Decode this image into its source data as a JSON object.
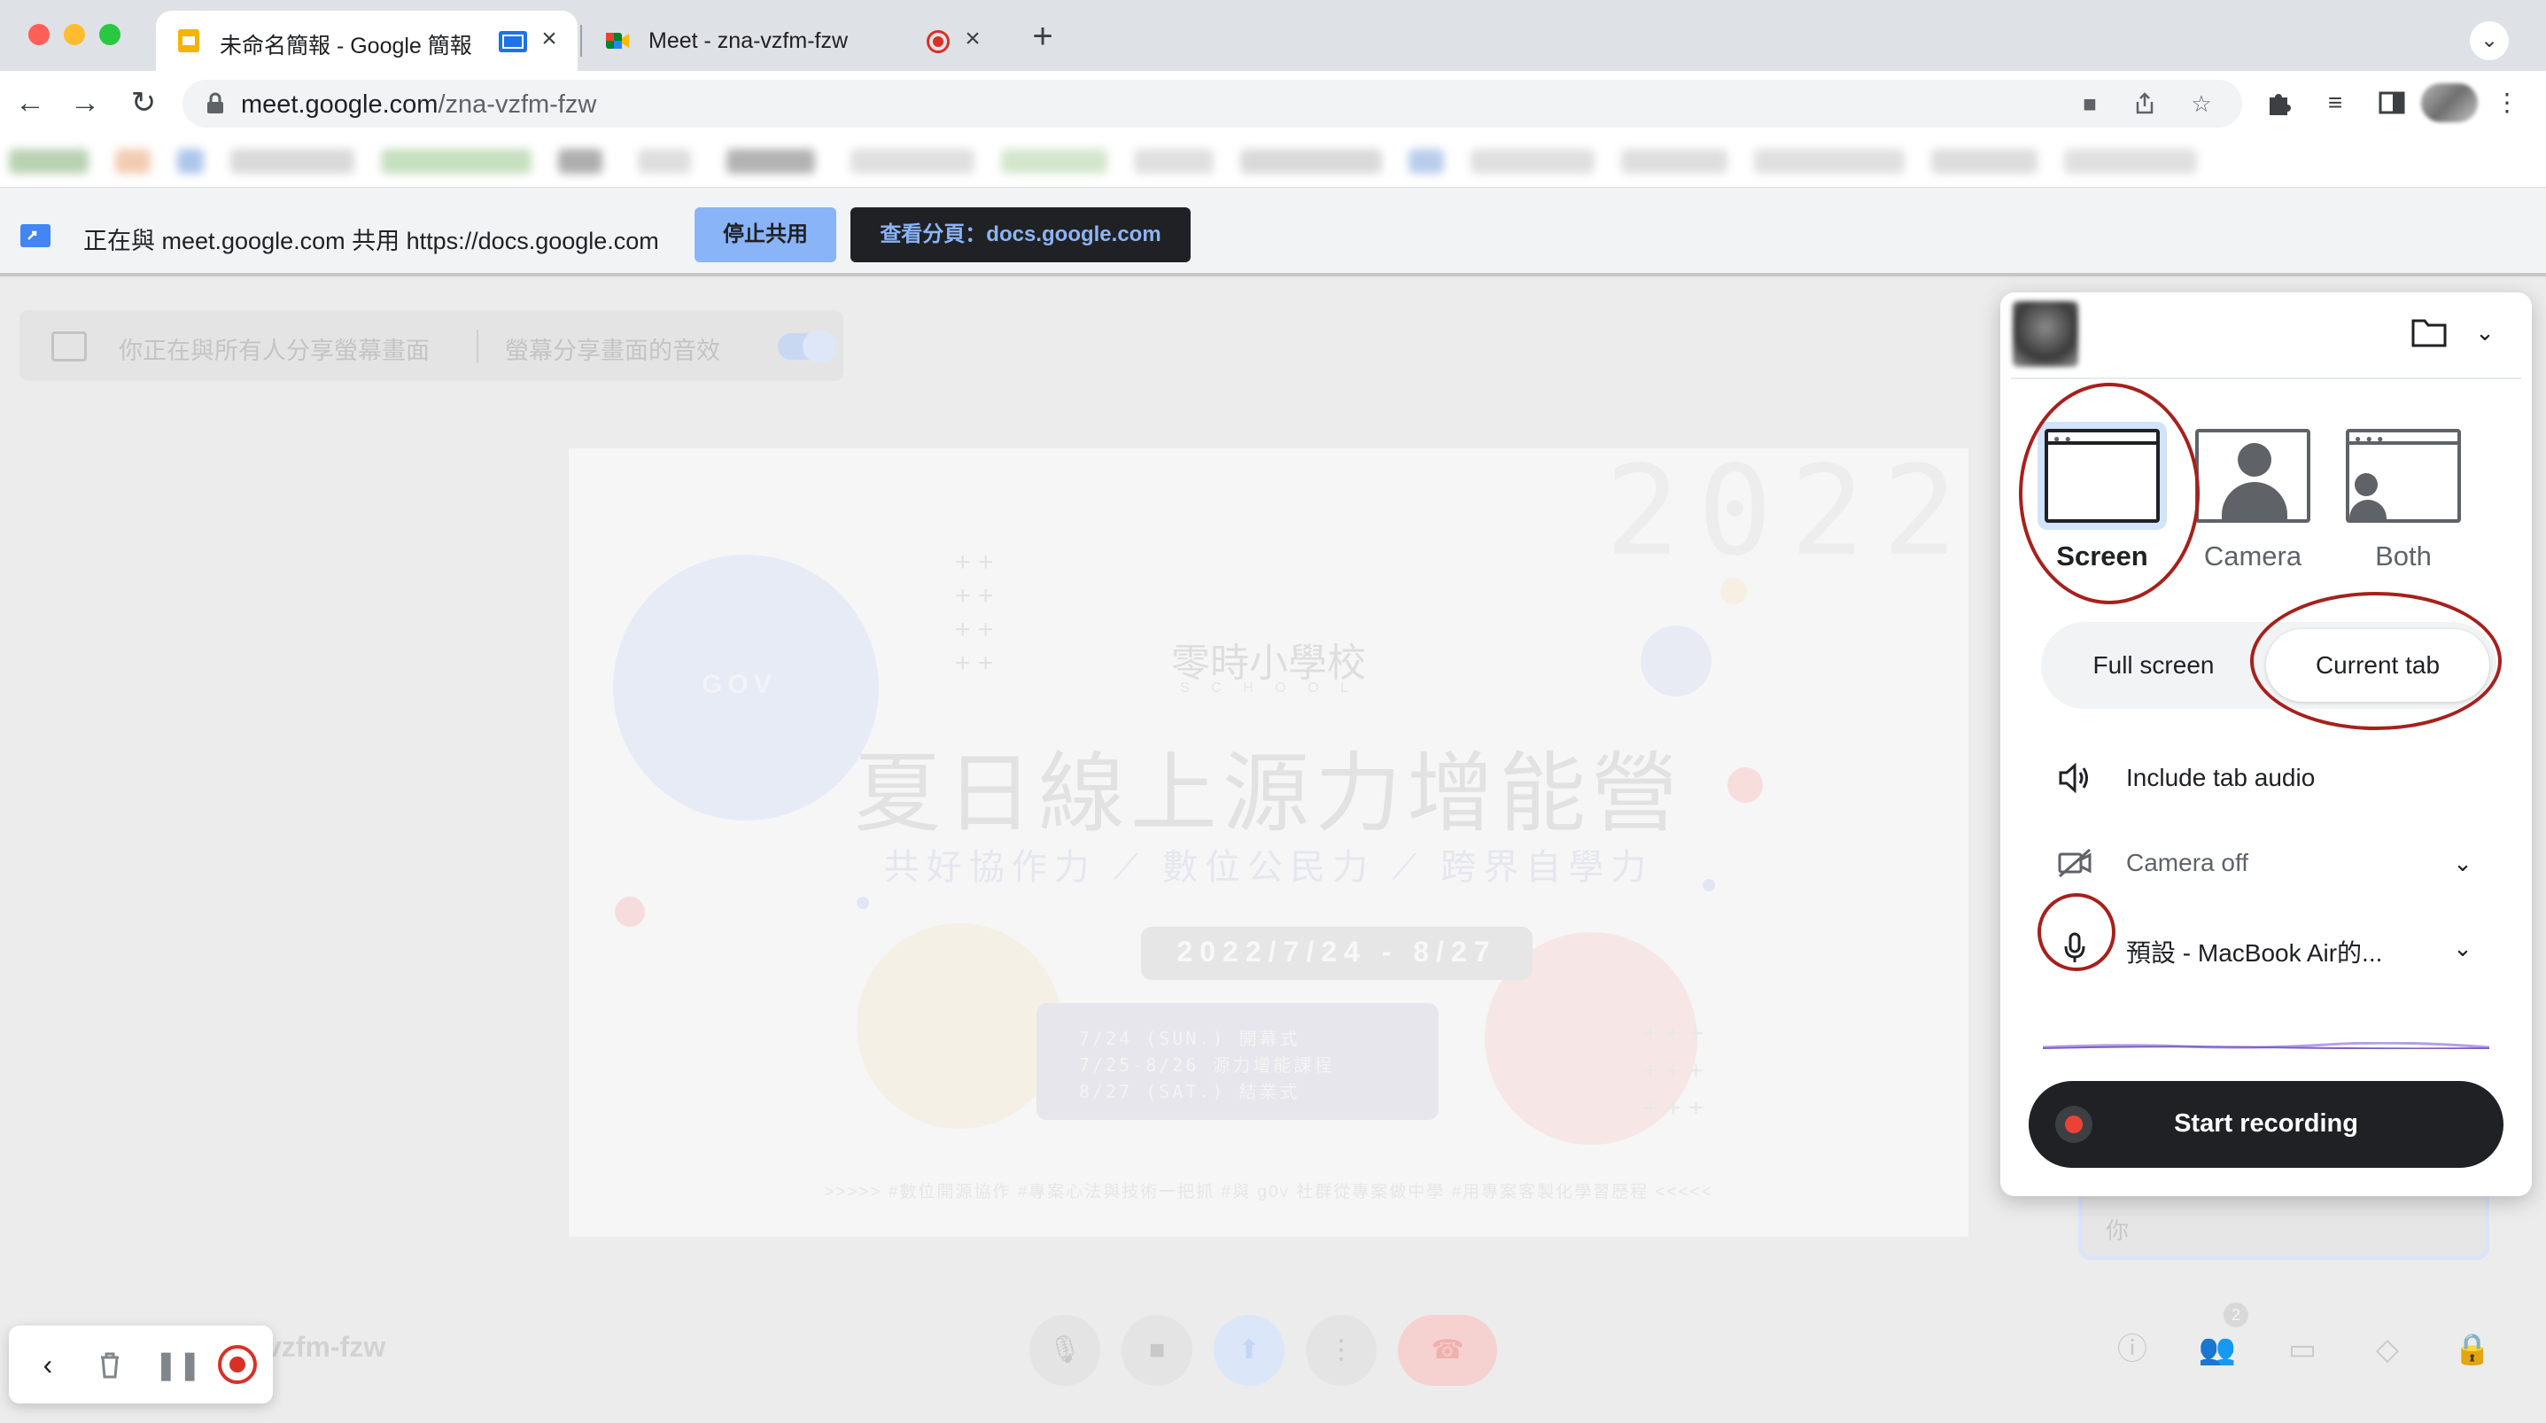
{
  "tabs": [
    {
      "title": "未命名簡報 - Google 簡報",
      "favicon": "google-slides-icon",
      "active": true
    },
    {
      "title": "Meet - zna-vzfm-fzw",
      "favicon": "google-meet-icon",
      "active": false,
      "recording": true
    }
  ],
  "toolbar": {
    "url_host": "meet.google.com",
    "url_path": "/zna-vzfm-fzw"
  },
  "infobar": {
    "message": "正在與 meet.google.com 共用 https://docs.google.com",
    "stop_label": "停止共用",
    "view_label": "查看分頁：docs.google.com"
  },
  "meet": {
    "share_banner_text": "你正在與所有人分享螢幕畫面",
    "share_audio_text": "螢幕分享畫面的音效",
    "meeting_code_partial": "vzfm-fzw",
    "self_tile_label": "你",
    "participants_badge": "2",
    "slide": {
      "title": "夏日線上源力增能營",
      "subtitle": "共好協作力 ⟋ 數位公民力 ⟋ 跨界自學力",
      "school": "零時小學校",
      "school_en": "S C H O O L",
      "year": "2022",
      "gov": "GOV",
      "dates": "2022/7/24 - 8/27",
      "schedule": [
        "7/24 (SUN.)   開幕式",
        "7/25-8/26   源力增能課程",
        "8/27 (SAT.)   結業式"
      ],
      "footer": ">>>>> #數位開源協作 #專案心法與技術一把抓 #與 g0v 社群從專案做中學 #用專案客製化學習歷程 <<<<<"
    }
  },
  "recorder": {
    "modes": [
      {
        "label": "Screen",
        "selected": true,
        "icon": "screen-icon"
      },
      {
        "label": "Camera",
        "selected": false,
        "icon": "camera-person-icon"
      },
      {
        "label": "Both",
        "selected": false,
        "icon": "both-icon"
      }
    ],
    "scope_full": "Full screen",
    "scope_tab": "Current tab",
    "scope_selected": "Current tab",
    "tab_audio_label": "Include tab audio",
    "camera_label": "Camera off",
    "mic_label": "預設 - MacBook Air的...",
    "start_label": "Start recording"
  },
  "colors": {
    "accent_blue": "#8ab4f8",
    "dark": "#202124",
    "record_red": "#ea4335",
    "annotation_red": "#a7201c"
  }
}
